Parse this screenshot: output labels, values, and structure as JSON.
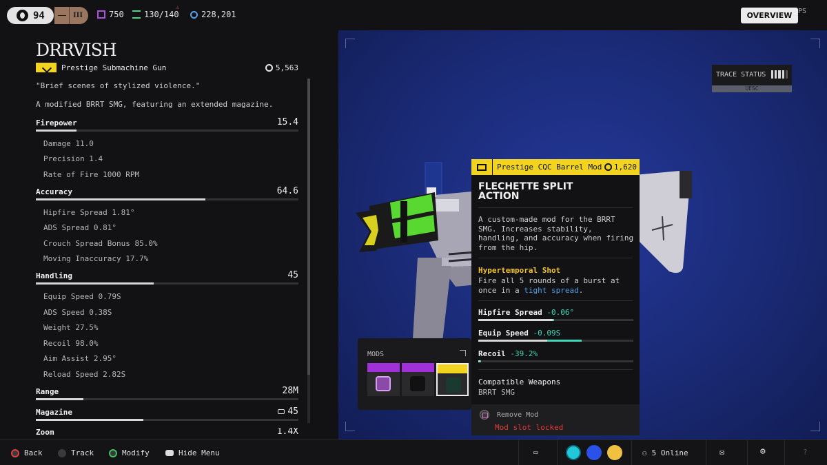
{
  "topbar": {
    "level": "94",
    "rank": "III",
    "currency_1": "750",
    "currency_2": "130/140",
    "currency_3": "228,201",
    "overview_label": "OVERVIEW",
    "fps_label": "PS"
  },
  "weapon": {
    "name": "DRRVISH",
    "type": "Prestige Submachine Gun",
    "price": "5,563",
    "quote": "\"Brief scenes of stylized violence.\"",
    "description": "A modified BRRT SMG, featuring an extended magazine."
  },
  "stats": {
    "firepower": {
      "label": "Firepower",
      "value": "15.4",
      "fill": 0.154
    },
    "damage": "Damage 11.0",
    "precision": "Precision 1.4",
    "rate_of_fire": "Rate of Fire 1000 RPM",
    "accuracy": {
      "label": "Accuracy",
      "value": "64.6",
      "fill": 0.646
    },
    "hipfire_spread": "Hipfire Spread 1.81°",
    "ads_spread": "ADS Spread 0.81°",
    "crouch_spread": "Crouch Spread Bonus 85.0%",
    "moving_inaccuracy": "Moving Inaccuracy 17.7%",
    "handling": {
      "label": "Handling",
      "value": "45",
      "fill": 0.45
    },
    "equip_speed": "Equip Speed 0.79S",
    "ads_speed": "ADS Speed 0.38S",
    "weight": "Weight 27.5%",
    "recoil": "Recoil 98.0%",
    "aim_assist": "Aim Assist 2.95°",
    "reload_speed": "Reload Speed 2.82S",
    "range": {
      "label": "Range",
      "value": "28M",
      "fill": 0.18
    },
    "magazine": {
      "label": "Magazine",
      "value": "45",
      "fill": 0.41
    },
    "zoom": {
      "label": "Zoom",
      "value": "1.4X"
    }
  },
  "trace": {
    "label": "TRACE STATUS",
    "sub": "UESC"
  },
  "mods": {
    "title": "MODS"
  },
  "tooltip": {
    "category": "Prestige CQC Barrel Mod",
    "price": "1,620",
    "name": "FLECHETTE SPLIT ACTION",
    "description": "A custom-made mod for the BRRT SMG. Increases stability, handling, and accuracy when firing from the hip.",
    "perk_name": "Hypertemporal Shot",
    "perk_text_1": "Fire all 5 rounds of a burst at once in a ",
    "perk_highlight": "tight spread",
    "perk_text_2": ".",
    "stat1_label": "Hipfire Spread",
    "stat1_delta": "-0.06°",
    "stat2_label": "Equip Speed",
    "stat2_delta": "-0.09S",
    "stat3_label": "Recoil",
    "stat3_delta": "-39.2%",
    "compatible_label": "Compatible Weapons",
    "compatible_weapon": "BRRT SMG",
    "remove_label": "Remove Mod",
    "locked_label": "Mod slot locked"
  },
  "bottombar": {
    "back": "Back",
    "track": "Track",
    "modify": "Modify",
    "hide_menu": "Hide Menu",
    "online": "5 Online"
  },
  "colors": {
    "accent_yellow": "#f2d420",
    "mod_purple": "#a030d8",
    "gain_teal": "#3ed8b8",
    "locked_red": "#e03a3a",
    "scene_blue": "#1c2d7d"
  }
}
